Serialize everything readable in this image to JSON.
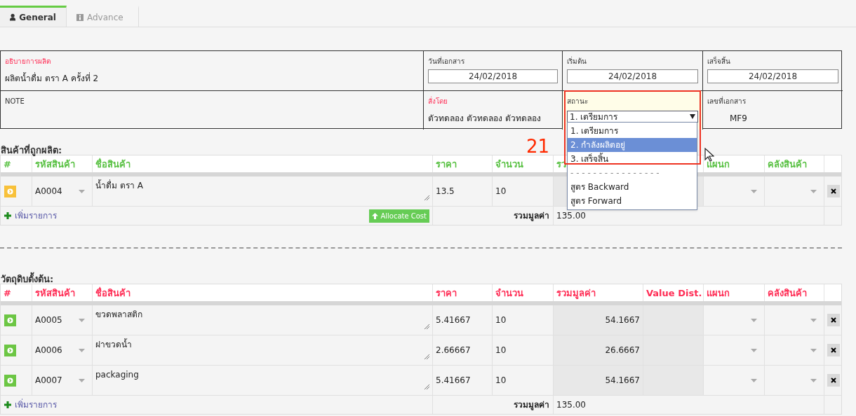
{
  "tabs": [
    {
      "label": "General",
      "selected": true
    },
    {
      "label": "Advance",
      "selected": false
    }
  ],
  "info": {
    "cells": [
      {
        "kind": "text",
        "label": "อธิบายการผลิต",
        "required": true,
        "value": "ผลิตน้ำดื่ม ตรา A  ครั้งที่ 2"
      },
      {
        "kind": "date",
        "label": "วันที่เอกสาร",
        "required": false,
        "value": "24/02/2018"
      },
      {
        "kind": "date",
        "label": "เริ่มต้น",
        "required": false,
        "value": "24/02/2018"
      },
      {
        "kind": "date",
        "label": "เสร็จสิ้น",
        "required": false,
        "value": "24/02/2018"
      },
      {
        "kind": "note",
        "label": "NOTE",
        "required": false
      },
      {
        "kind": "text",
        "label": "สั่งโดย",
        "required": true,
        "value": "ตัวทดลอง  ตัวทดลอง ตัวทดลอง"
      },
      {
        "kind": "select",
        "label": "สถานะ",
        "required": false,
        "value": "1. เตรียมการ",
        "annotation": "21",
        "options": [
          {
            "label": "1. เตรียมการ",
            "highlighted": false,
            "kind": "option"
          },
          {
            "label": "2. กำลังผลิตอยู่",
            "highlighted": true,
            "kind": "option"
          },
          {
            "label": "3. เสร็จสิ้น",
            "highlighted": false,
            "kind": "option"
          },
          {
            "label": "- - - - - - - - - - - - - - - -",
            "kind": "separator"
          },
          {
            "label": "สูตร Backward",
            "highlighted": false,
            "kind": "option"
          },
          {
            "label": "สูตร Forward",
            "highlighted": false,
            "kind": "option"
          }
        ]
      },
      {
        "kind": "number",
        "label": "เลขที่เอกสาร",
        "required": false,
        "value": "MF9"
      }
    ]
  },
  "sections": [
    {
      "title": "สินค้าที่ถูกผลิต:",
      "kind": "output",
      "columns": [
        "#",
        "รหัสสินค้า",
        "ชื่อสินค้า",
        "ราคา",
        "จำนวน",
        "รว",
        "",
        "แผนก",
        "คลังสินค้า",
        ""
      ],
      "rows": [
        {
          "color": "#f8c13a",
          "code": "A0004",
          "name": "น้ำดื่ม ตรา A",
          "price": "13.5",
          "qty": "10",
          "total": ""
        }
      ],
      "footer": {
        "add": "เพิ่มรายการ",
        "button": "Allocate Cost",
        "total_label": "รวมมูลค่า",
        "total": "135.00"
      }
    },
    {
      "title": "วัตถุดิบตั้งต้น:",
      "kind": "input",
      "columns": [
        "#",
        "รหัสสินค้า",
        "ชื่อสินค้า",
        "ราคา",
        "จำนวน",
        "รวมมูลค่า",
        "Value Dist.",
        "แผนก",
        "คลังสินค้า",
        ""
      ],
      "rows": [
        {
          "color": "#6cc644",
          "code": "A0005",
          "name": "ขวดพลาสติก",
          "price": "5.41667",
          "qty": "10",
          "total": "54.1667"
        },
        {
          "color": "#6cc644",
          "code": "A0006",
          "name": "ฝาขวดน้ำ",
          "price": "2.66667",
          "qty": "10",
          "total": "26.6667"
        },
        {
          "color": "#6cc644",
          "code": "A0007",
          "name": "packaging",
          "price": "5.41667",
          "qty": "10",
          "total": "54.1667"
        }
      ],
      "footer": {
        "add": "เพิ่มรายการ",
        "total_label": "รวมมูลค่า",
        "total": "135.00"
      }
    }
  ]
}
